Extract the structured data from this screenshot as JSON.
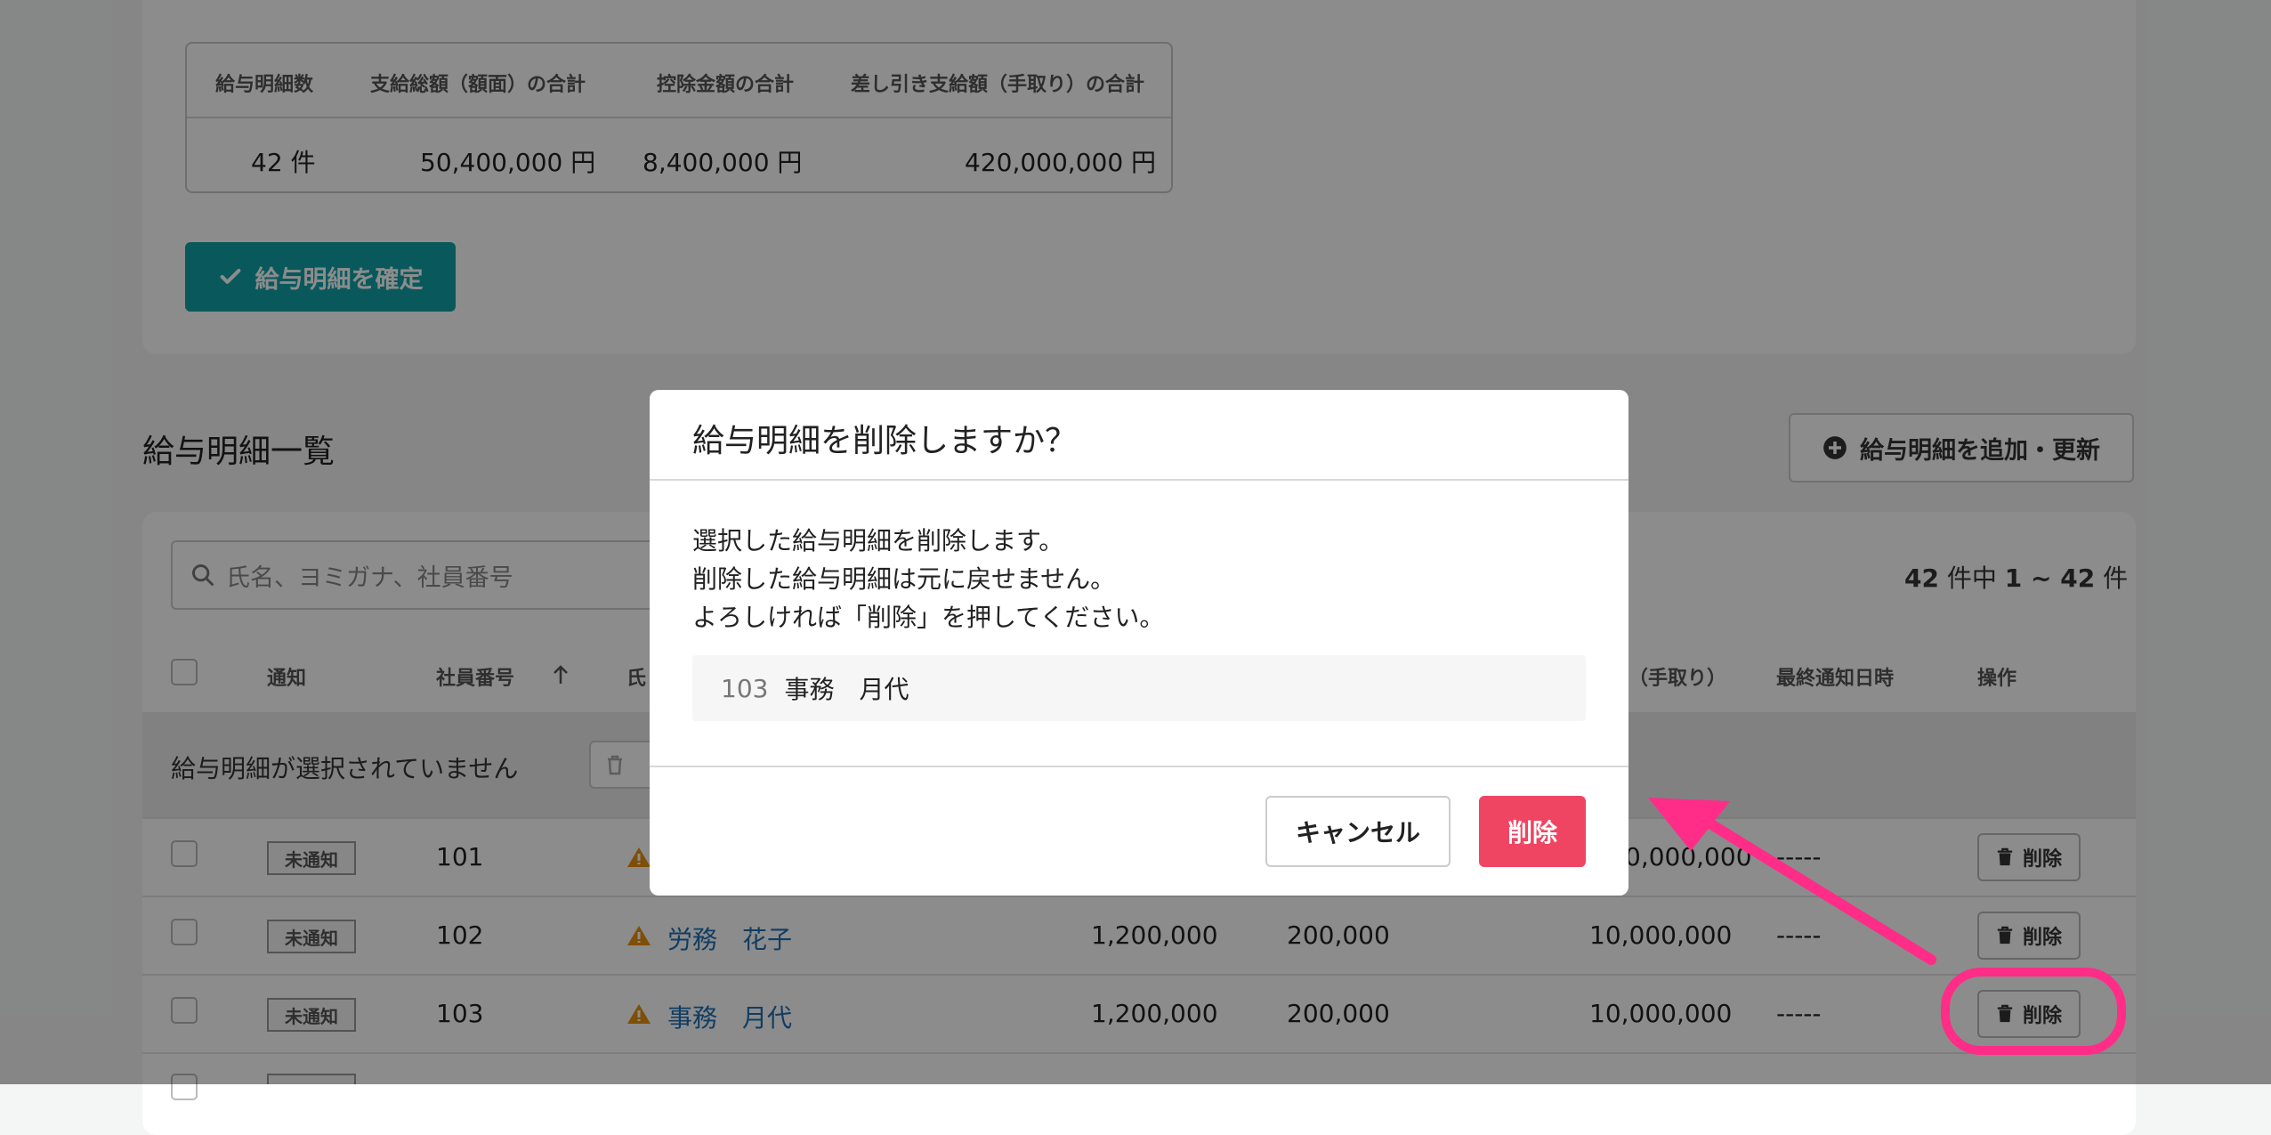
{
  "summary": {
    "headers": [
      "給与明細数",
      "支給総額（額面）の合計",
      "控除金額の合計",
      "差し引き支給額（手取り）の合計"
    ],
    "values": [
      "42 件",
      "50,400,000 円",
      "8,400,000 円",
      "420,000,000 円"
    ]
  },
  "confirm_button": {
    "label": "給与明細を確定",
    "icon": "check-icon"
  },
  "list": {
    "title": "給与明細一覧",
    "add_button_label": "給与明細を追加・更新",
    "search_placeholder": "氏名、ヨミガナ、社員番号",
    "count": {
      "total": "42",
      "middle": "件中",
      "range": "1 ~ 42",
      "suffix": "件"
    },
    "columns": {
      "notify": "通知",
      "employee_no": "社員番号",
      "name_partial": "氏",
      "net_partial": "（手取り）",
      "last_notified": "最終通知日時",
      "actions": "操作"
    },
    "selection_text": "給与明細が選択されていません",
    "rows": [
      {
        "badge": "未通知",
        "no": "101",
        "name": "",
        "gross": "",
        "deduction": "",
        "net": "0,000,000",
        "last": "-----",
        "action": "削除"
      },
      {
        "badge": "未通知",
        "no": "102",
        "name": "労務　花子",
        "gross": "1,200,000",
        "deduction": "200,000",
        "net": "10,000,000",
        "last": "-----",
        "action": "削除"
      },
      {
        "badge": "未通知",
        "no": "103",
        "name": "事務　月代",
        "gross": "1,200,000",
        "deduction": "200,000",
        "net": "10,000,000",
        "last": "-----",
        "action": "削除"
      }
    ]
  },
  "modal": {
    "title": "給与明細を削除しますか？",
    "body": [
      "選択した給与明細を削除します。",
      "削除した給与明細は元に戻せません。",
      "よろしければ「削除」を押してください。"
    ],
    "target_no": "103",
    "target_name": "事務　月代",
    "cancel_label": "キャンセル",
    "delete_label": "削除"
  },
  "colors": {
    "accent_teal": "#12a3a8",
    "danger": "#ef4562",
    "link": "#1f6fb3",
    "annotation": "#ff2d87"
  }
}
